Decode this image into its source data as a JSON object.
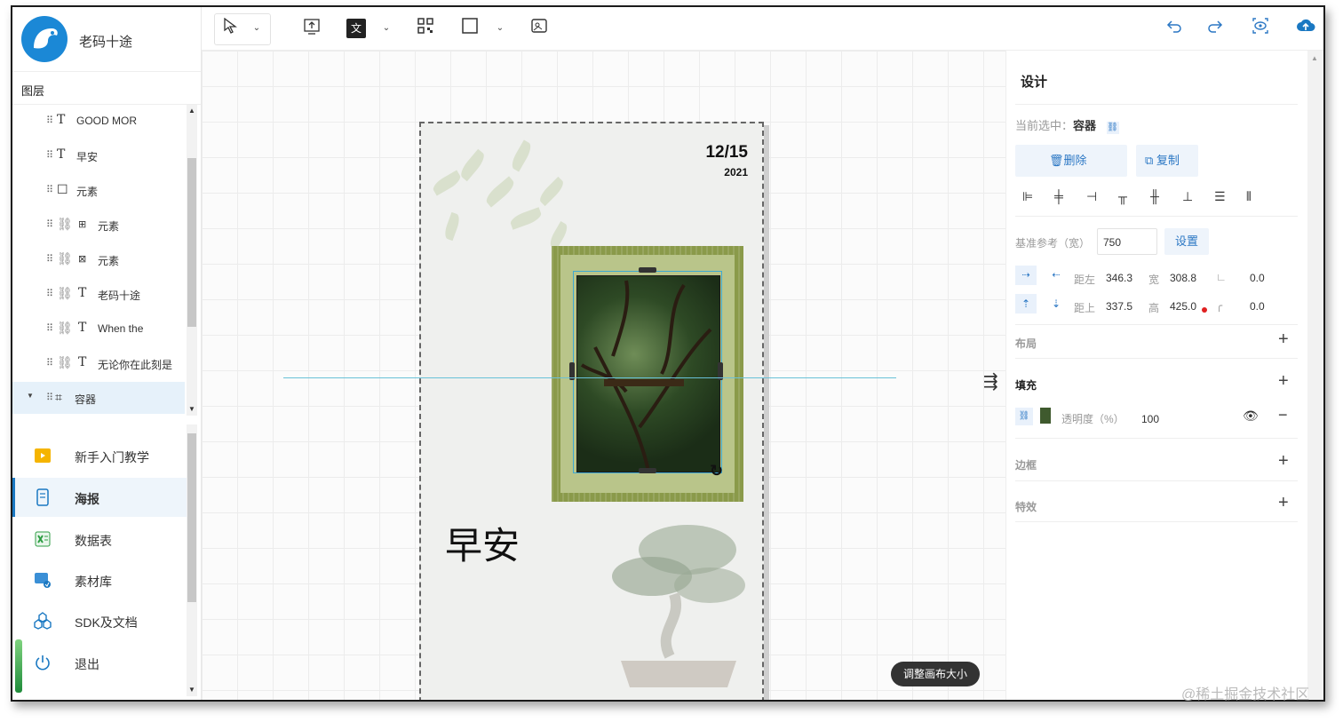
{
  "app": {
    "name": "老码十途"
  },
  "layers_panel": {
    "title": "图层",
    "items": [
      {
        "icon": "T",
        "label": "GOOD MOR"
      },
      {
        "icon": "T",
        "label": "早安"
      },
      {
        "icon": "☐",
        "label": "元素"
      },
      {
        "icon": "⊞",
        "label": "元素"
      },
      {
        "icon": "⊠",
        "label": "元素"
      },
      {
        "icon": "T",
        "label": "老码十途"
      },
      {
        "icon": "T",
        "label": "When the"
      },
      {
        "icon": "T",
        "label": "无论你在此刻是"
      },
      {
        "icon": "⌗",
        "label": "容器"
      }
    ]
  },
  "nav": {
    "items": [
      {
        "label": "新手入门教学",
        "icon": "video-icon",
        "color": "#f5b400"
      },
      {
        "label": "海报",
        "icon": "phone-poster-icon",
        "color": "#1a78c2",
        "active": true
      },
      {
        "label": "数据表",
        "icon": "excel-icon",
        "color": "#2f9e44"
      },
      {
        "label": "素材库",
        "icon": "materials-icon",
        "color": "#3a8fd6"
      },
      {
        "label": "SDK及文档",
        "icon": "sdk-icon",
        "color": "#1a78c2"
      },
      {
        "label": "退出",
        "icon": "power-icon",
        "color": "#1a78c2"
      }
    ]
  },
  "toolbar": {
    "text_tool": "文"
  },
  "poster": {
    "date": "12/15",
    "year": "2021",
    "greeting": "早安"
  },
  "canvas": {
    "resize_button": "调整画布大小"
  },
  "design_panel": {
    "title": "设计",
    "selected_label": "当前选中：",
    "selected_value": "容器",
    "delete_label": "删除",
    "copy_label": "复制",
    "base_ref_label": "基准参考（宽）",
    "base_ref_value": "750",
    "set_button": "设置",
    "left_label": "距左",
    "left_value": "346.3",
    "width_label": "宽",
    "width_value": "308.8",
    "angle_value": "0.0",
    "top_label": "距上",
    "top_value": "337.5",
    "height_label": "高",
    "height_value": "425.0",
    "radius_value": "0.0",
    "layout_label": "布局",
    "fill_label": "填充",
    "opacity_label": "透明度（%）",
    "opacity_value": "100",
    "border_label": "边框",
    "effects_label": "特效"
  },
  "watermark": "@稀土掘金技术社区",
  "colors": {
    "accent": "#1a78c2",
    "guide": "#69c1d8"
  }
}
